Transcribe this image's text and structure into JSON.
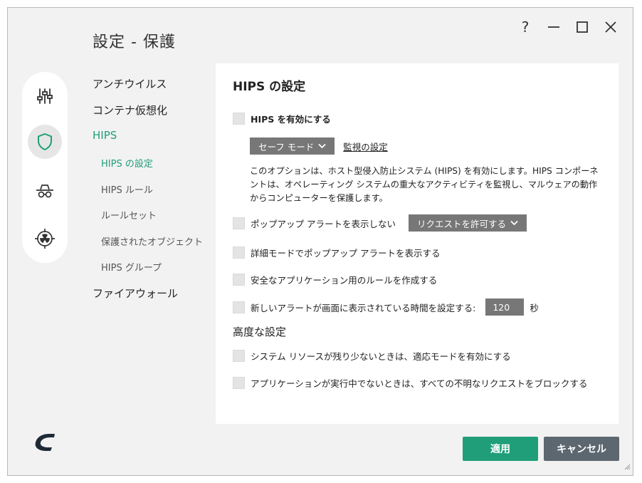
{
  "window": {
    "title": "設定 - 保護",
    "help_glyph": "?"
  },
  "iconbar": {
    "items": [
      {
        "icon": "sliders-icon"
      },
      {
        "icon": "shield-icon",
        "active": true
      },
      {
        "icon": "spy-icon"
      },
      {
        "icon": "radiation-target-icon"
      }
    ]
  },
  "nav": {
    "items": [
      {
        "label": "アンチウイルス",
        "level": 1
      },
      {
        "label": "コンテナ仮想化",
        "level": 1
      },
      {
        "label": "HIPS",
        "level": 1,
        "active": true
      },
      {
        "label": "HIPS の設定",
        "level": 2,
        "active": true
      },
      {
        "label": "HIPS ルール",
        "level": 2
      },
      {
        "label": "ルールセット",
        "level": 2
      },
      {
        "label": "保護されたオブジェクト",
        "level": 2
      },
      {
        "label": "HIPS グループ",
        "level": 2
      },
      {
        "label": "ファイアウォール",
        "level": 1
      }
    ]
  },
  "panel": {
    "title": "HIPS の設定",
    "enable_hips": {
      "label": "HIPS を有効にする",
      "checked": false
    },
    "mode_dropdown": "セーフ モード",
    "monitor_link": "監視の設定",
    "description": "このオプションは、ホスト型侵入防止システム (HIPS) を有効にします。HIPS コンポーネントは、オペレーティング システムの重大なアクティビティを監視し、マルウェアの動作からコンピューターを保護します。",
    "no_popup": {
      "label": "ポップアップ アラートを表示しない",
      "checked": false
    },
    "request_dropdown": "リクエストを許可する",
    "verbose_popup": {
      "label": "詳細モードでポップアップ アラートを表示する",
      "checked": false
    },
    "safe_rules": {
      "label": "安全なアプリケーション用のルールを作成する",
      "checked": false
    },
    "alert_time": {
      "label": "新しいアラートが画面に表示されている時間を設定する:",
      "value": "120",
      "unit": "秒",
      "checked": false
    },
    "advanced_title": "高度な設定",
    "adaptive_mode": {
      "label": "システム リソースが残り少ないときは、適応モードを有効にする",
      "checked": false
    },
    "block_unknown": {
      "label": "アプリケーションが実行中でないときは、すべての不明なリクエストをブロックする",
      "checked": false
    }
  },
  "footer": {
    "logo": "comodo-c-logo",
    "apply_label": "適用",
    "cancel_label": "キャンセル"
  },
  "colors": {
    "accent": "#1f9e79",
    "cancel": "#5d6770",
    "dropdown": "#777777"
  }
}
